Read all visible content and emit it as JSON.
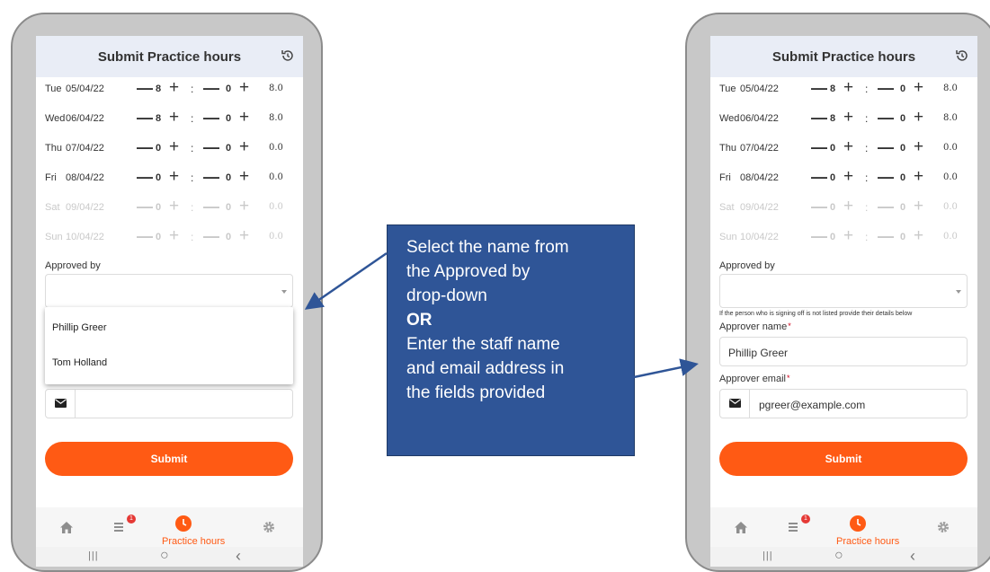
{
  "app": {
    "title": "Submit Practice hours",
    "history_icon": "history-icon"
  },
  "days": [
    {
      "day": "Tue",
      "date": "05/04/22",
      "hours": "8",
      "minutes": "0",
      "total": "8.0",
      "disabled": false
    },
    {
      "day": "Wed",
      "date": "06/04/22",
      "hours": "8",
      "minutes": "0",
      "total": "8.0",
      "disabled": false
    },
    {
      "day": "Thu",
      "date": "07/04/22",
      "hours": "0",
      "minutes": "0",
      "total": "0.0",
      "disabled": false
    },
    {
      "day": "Fri",
      "date": "08/04/22",
      "hours": "0",
      "minutes": "0",
      "total": "0.0",
      "disabled": false
    },
    {
      "day": "Sat",
      "date": "09/04/22",
      "hours": "0",
      "minutes": "0",
      "total": "0.0",
      "disabled": true
    },
    {
      "day": "Sun",
      "date": "10/04/22",
      "hours": "0",
      "minutes": "0",
      "total": "0.0",
      "disabled": true
    }
  ],
  "controls": {
    "minus": "—",
    "plus": "+",
    "colon": ":"
  },
  "form": {
    "approved_by_label": "Approved by",
    "approved_by_value": "",
    "dropdown_options": [
      "Phillip Greer",
      "Tom Holland"
    ],
    "hint": "If the person who is signing off is not listed provide their details below",
    "approver_name_label": "Approver name",
    "approver_name_value": "Phillip Greer",
    "approver_email_label": "Approver email",
    "approver_email_value": "pgreer@example.com",
    "required_mark": "*",
    "submit_label": "Submit"
  },
  "nav": {
    "home_icon": "home-icon",
    "list_icon": "list-icon",
    "badge_count": "1",
    "practice_icon": "clock-icon",
    "practice_label": "Practice hours",
    "settings_icon": "gear-icon"
  },
  "system_nav": {
    "recent": "|||",
    "home": "○",
    "back": "‹"
  },
  "callout": {
    "line1": "Select the name from",
    "line2": "the Approved by",
    "line3": "drop-down",
    "or": "OR",
    "line5": "Enter the staff name",
    "line6": "and email address in",
    "line7": "the fields provided"
  },
  "colors": {
    "accent": "#ff5a14",
    "callout_bg": "#2f5597",
    "header_bg": "#e9edf6",
    "phone_frame": "#c8c8c8"
  }
}
